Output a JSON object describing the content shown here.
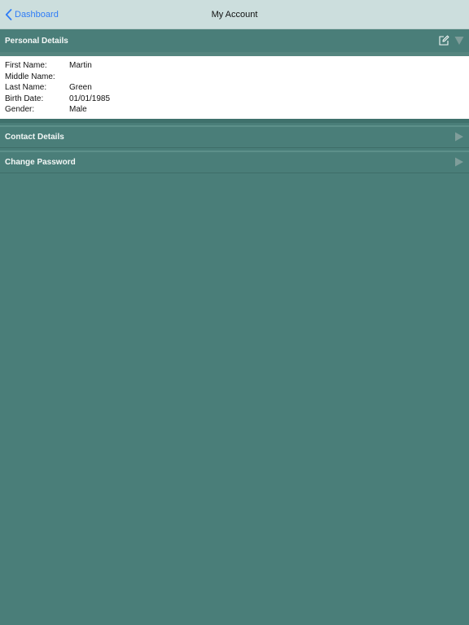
{
  "navbar": {
    "back_label": "Dashboard",
    "title": "My Account"
  },
  "sections": {
    "personal": {
      "title": "Personal Details",
      "expanded": true
    },
    "contact": {
      "title": "Contact Details",
      "expanded": false
    },
    "password": {
      "title": "Change Password",
      "expanded": false
    }
  },
  "personal_details": {
    "fields": [
      {
        "label": "First Name:",
        "value": "Martin"
      },
      {
        "label": "Middle Name:",
        "value": ""
      },
      {
        "label": "Last Name:",
        "value": "Green"
      },
      {
        "label": "Birth Date:",
        "value": "01/01/1985"
      },
      {
        "label": "Gender:",
        "value": "Male"
      }
    ]
  },
  "colors": {
    "navbar_bg": "#ccdedd",
    "accent_link": "#2f7cf6",
    "content_bg": "#4a7e79",
    "arrow": "#7f9d9a"
  },
  "icons": [
    "chevron-left-icon",
    "edit-icon",
    "triangle-down-icon",
    "triangle-right-icon"
  ]
}
